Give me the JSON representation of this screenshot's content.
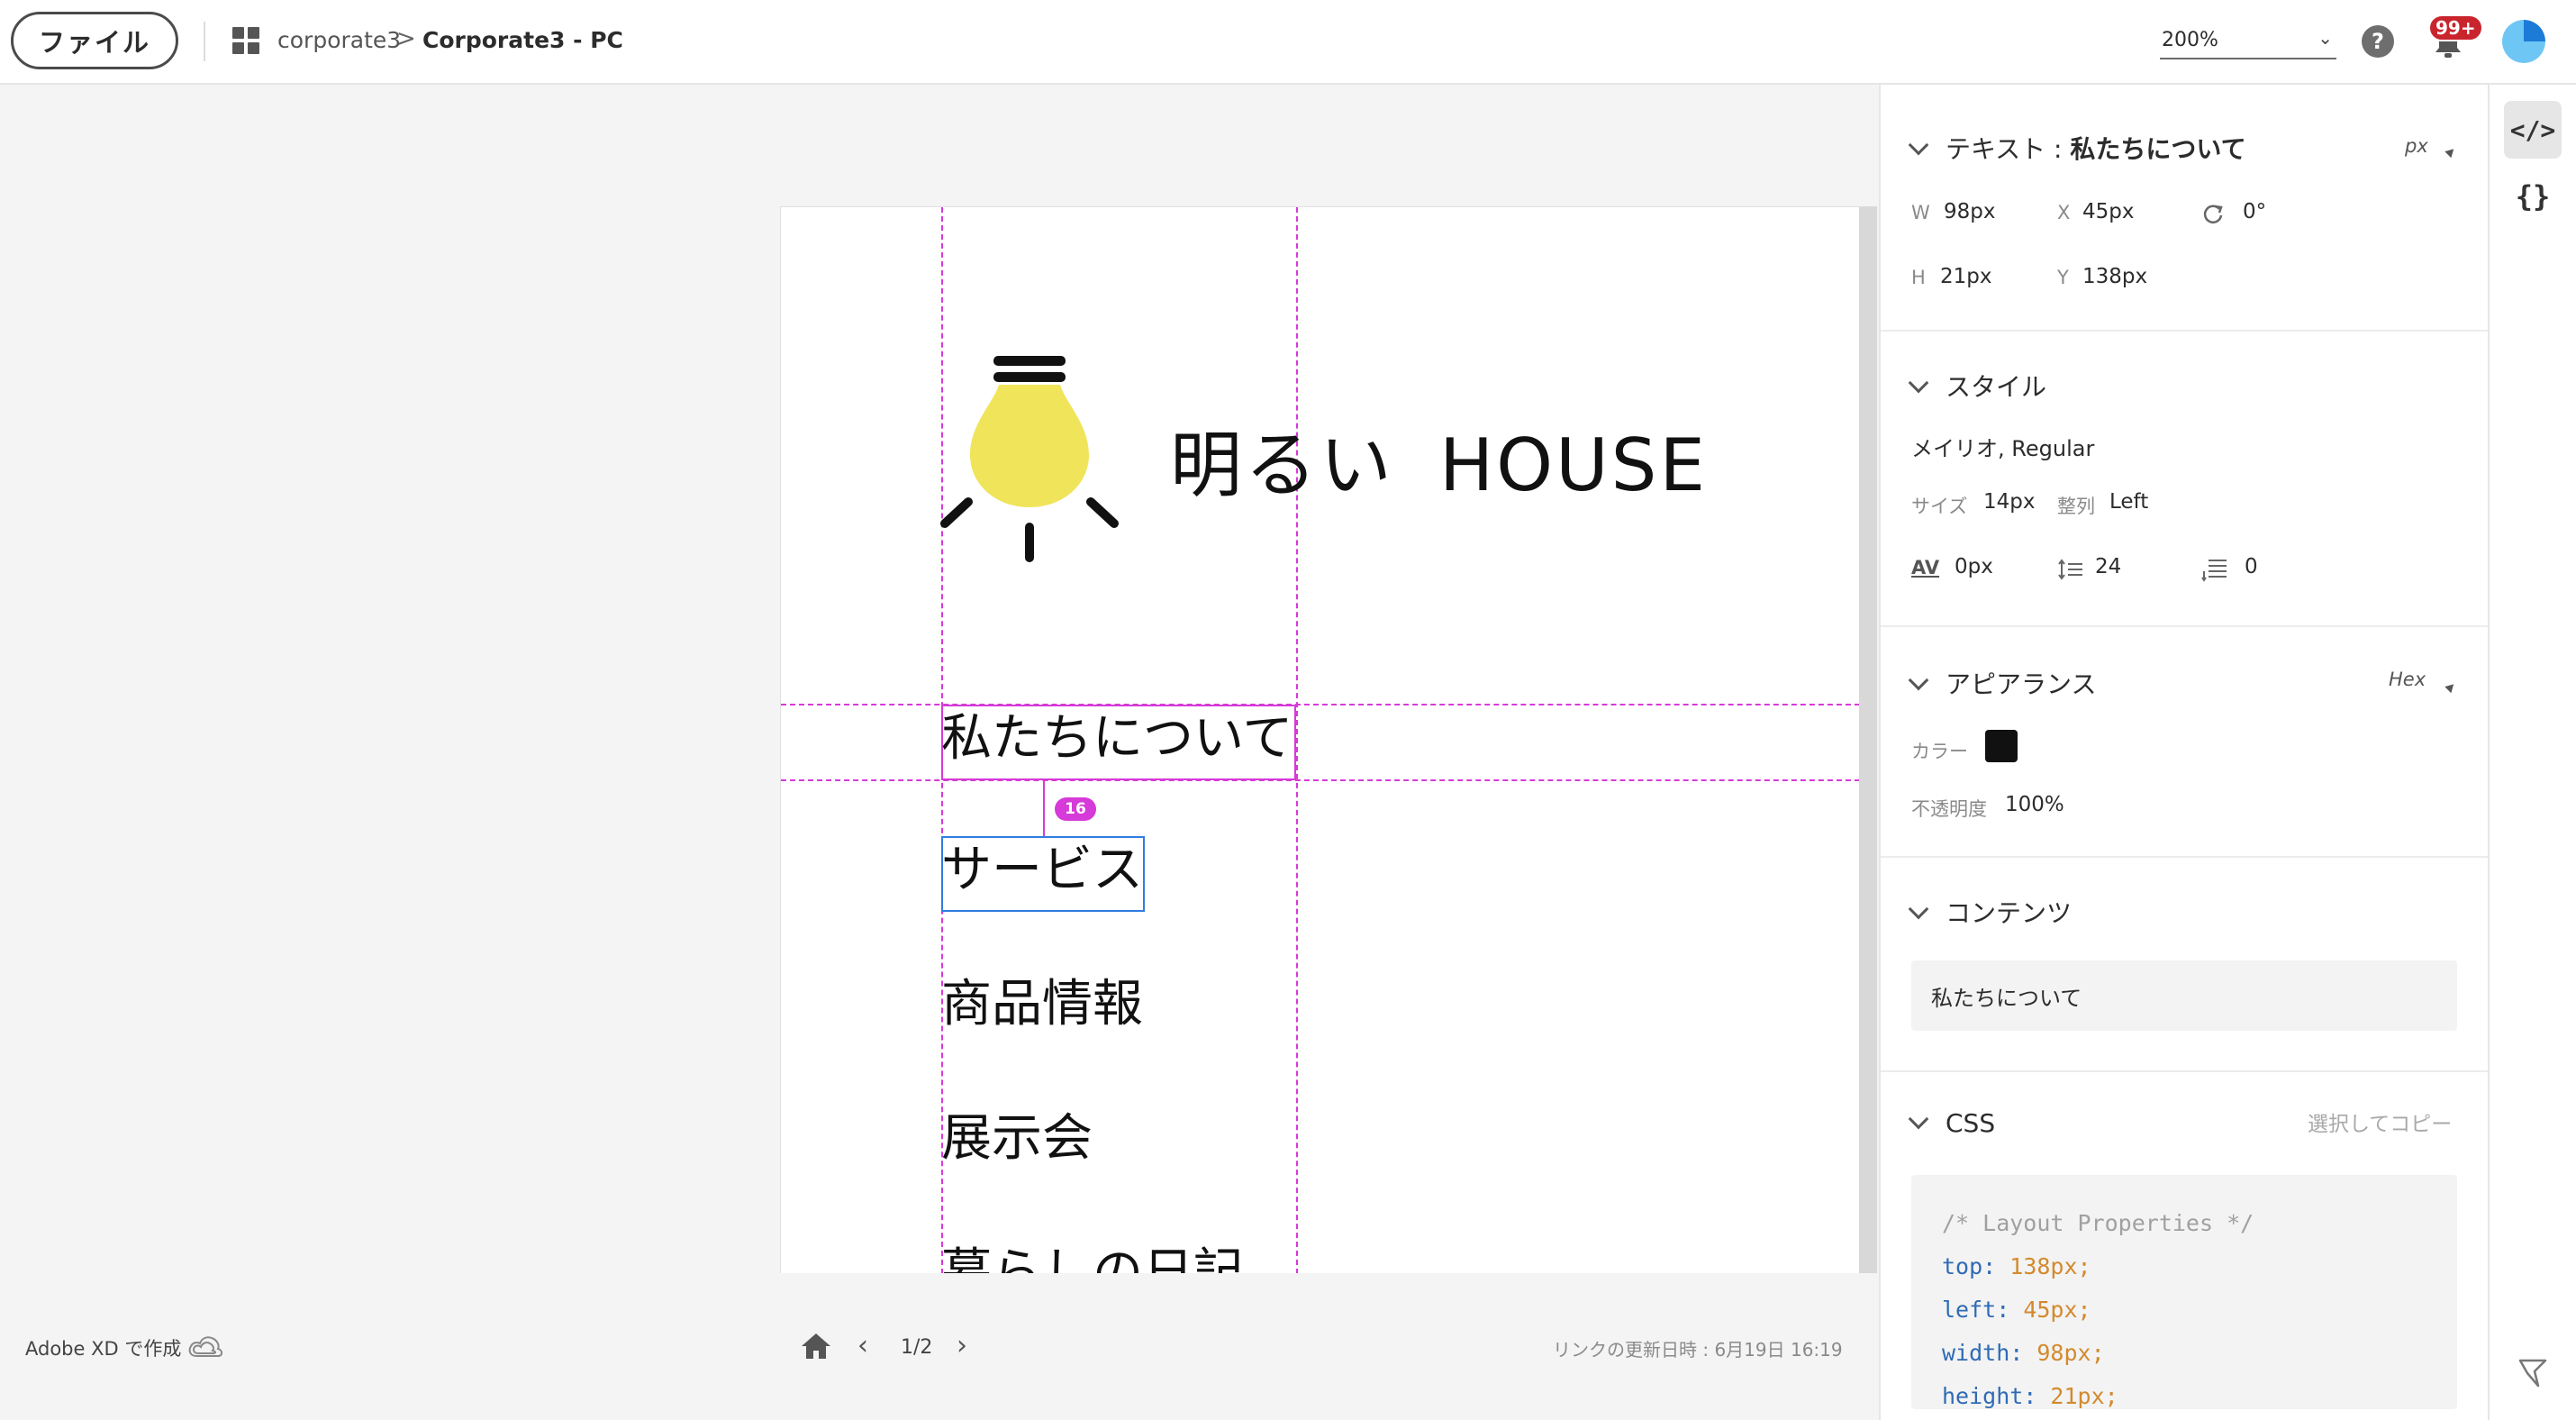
{
  "header": {
    "file_button": "ファイル",
    "breadcrumb_project": "corporate3",
    "breadcrumb_separator": ">",
    "breadcrumb_artboard": "Corporate3 - PC",
    "zoom_value": "200%",
    "help_icon": "?",
    "notification_badge": "99+"
  },
  "artboard": {
    "logo_text_ja": "明るい",
    "logo_text_en": "HOUSE",
    "menu_items": [
      "私たちについて",
      "サービス",
      "商品情報",
      "展示会",
      "暮らしの日記"
    ],
    "distance_badge": "16",
    "bulb_color": "#F0E45A"
  },
  "footer": {
    "made_with": "Adobe XD で作成",
    "page_indicator": "1/2",
    "updated": "リンクの更新日時 : 6月19日 16:19"
  },
  "panel": {
    "text_section": {
      "label": "テキスト :",
      "name": "私たちについて",
      "unit": "px",
      "w_label": "W",
      "w_value": "98px",
      "x_label": "X",
      "x_value": "45px",
      "rotation_value": "0°",
      "h_label": "H",
      "h_value": "21px",
      "y_label": "Y",
      "y_value": "138px"
    },
    "style_section": {
      "title": "スタイル",
      "font": "メイリオ, Regular",
      "size_label": "サイズ",
      "size_value": "14px",
      "align_label": "整列",
      "align_value": "Left",
      "char_spacing_value": "0px",
      "line_spacing_value": "24",
      "para_spacing_value": "0"
    },
    "appearance_section": {
      "title": "アピアランス",
      "mode": "Hex",
      "color_label": "カラー",
      "color_value": "#111111",
      "opacity_label": "不透明度",
      "opacity_value": "100%"
    },
    "content_section": {
      "title": "コンテンツ",
      "value": "私たちについて"
    },
    "css_section": {
      "title": "CSS",
      "copy_label": "選択してコピー",
      "comment": "/* Layout Properties */",
      "lines": [
        {
          "prop": "top:",
          "val": "138px;"
        },
        {
          "prop": "left:",
          "val": "45px;"
        },
        {
          "prop": "width:",
          "val": "98px;"
        },
        {
          "prop": "height:",
          "val": "21px;"
        }
      ]
    }
  },
  "rail": {
    "code_icon": "</>",
    "braces_icon": "{}"
  }
}
